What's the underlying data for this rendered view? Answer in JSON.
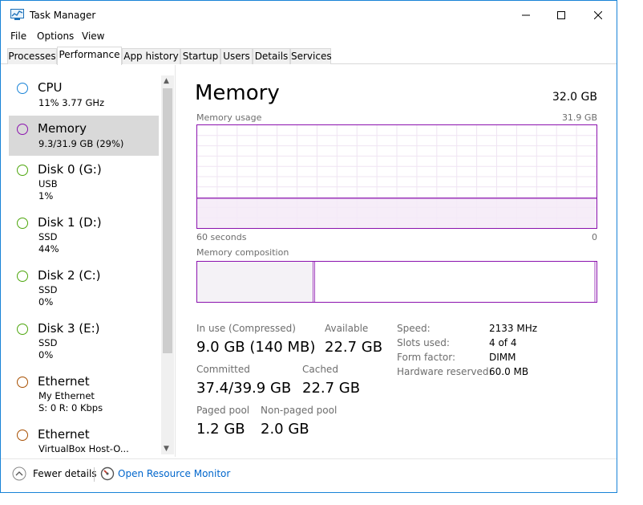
{
  "window": {
    "title": "Task Manager"
  },
  "menu": [
    "File",
    "Options",
    "View"
  ],
  "tabs": [
    {
      "label": "Processes"
    },
    {
      "label": "Performance"
    },
    {
      "label": "App history"
    },
    {
      "label": "Startup"
    },
    {
      "label": "Users"
    },
    {
      "label": "Details"
    },
    {
      "label": "Services"
    }
  ],
  "sidebar": {
    "items": [
      {
        "name": "CPU",
        "line1": "11%  3.77 GHz",
        "line2": "",
        "line3": "",
        "color": "#1883d7"
      },
      {
        "name": "Memory",
        "line1": "9.3/31.9 GB (29%)",
        "line2": "",
        "line3": "",
        "color": "#8b12ae"
      },
      {
        "name": "Disk 0 (G:)",
        "line1": "USB",
        "line2": "1%",
        "line3": "",
        "color": "#4da60c"
      },
      {
        "name": "Disk 1 (D:)",
        "line1": "SSD",
        "line2": "44%",
        "line3": "",
        "color": "#4da60c"
      },
      {
        "name": "Disk 2 (C:)",
        "line1": "SSD",
        "line2": "0%",
        "line3": "",
        "color": "#4da60c"
      },
      {
        "name": "Disk 3 (E:)",
        "line1": "SSD",
        "line2": "0%",
        "line3": "",
        "color": "#4da60c"
      },
      {
        "name": "Ethernet",
        "line1": "My Ethernet",
        "line2": "S: 0  R: 0 Kbps",
        "line3": "",
        "color": "#a74f01"
      },
      {
        "name": "Ethernet",
        "line1": "VirtualBox Host-O...",
        "line2": "",
        "line3": "",
        "color": "#a74f01"
      }
    ]
  },
  "main": {
    "heading": "Memory",
    "total": "32.0 GB",
    "usage_label": "Memory usage",
    "usage_max": "31.9 GB",
    "time_left": "60 seconds",
    "time_right": "0",
    "composition_label": "Memory composition",
    "usage_fraction": 0.29,
    "in_use_fraction": 0.29,
    "stats": {
      "in_use_label": "In use (Compressed)",
      "in_use_value": "9.0 GB (140 MB)",
      "available_label": "Available",
      "available_value": "22.7 GB",
      "committed_label": "Committed",
      "committed_value": "37.4/39.9 GB",
      "cached_label": "Cached",
      "cached_value": "22.7 GB",
      "paged_label": "Paged pool",
      "paged_value": "1.2 GB",
      "nonpaged_label": "Non-paged pool",
      "nonpaged_value": "2.0 GB"
    },
    "details": {
      "speed_label": "Speed:",
      "speed_value": "2133 MHz",
      "slots_label": "Slots used:",
      "slots_value": "4 of 4",
      "form_label": "Form factor:",
      "form_value": "DIMM",
      "reserved_label": "Hardware reserved:",
      "reserved_value": "60.0 MB"
    }
  },
  "bottom": {
    "fewer_details": "Fewer details",
    "open_resource_monitor": "Open Resource Monitor"
  },
  "colors": {
    "accent_memory": "#8b12ae",
    "link": "#0066cc"
  }
}
